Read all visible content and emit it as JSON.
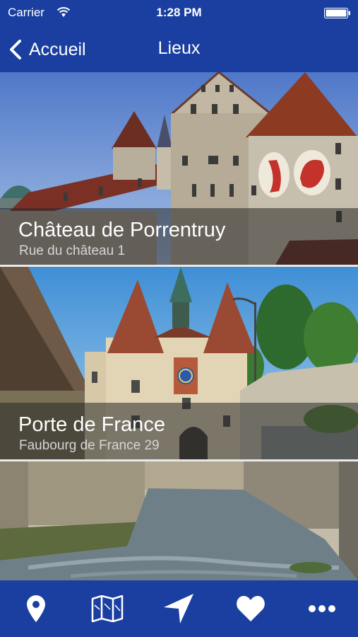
{
  "status": {
    "carrier": "Carrier",
    "time": "1:28 PM"
  },
  "nav": {
    "back_label": "Accueil",
    "title": "Lieux"
  },
  "places": [
    {
      "name": "Château de Porrentruy",
      "address": "Rue du château 1"
    },
    {
      "name": "Porte de France",
      "address": "Faubourg de France 29"
    },
    {
      "name": "",
      "address": ""
    }
  ],
  "tabs": [
    {
      "icon": "location-pin-icon"
    },
    {
      "icon": "map-icon"
    },
    {
      "icon": "navigation-arrow-icon"
    },
    {
      "icon": "heart-icon"
    },
    {
      "icon": "more-icon"
    }
  ],
  "colors": {
    "brand": "#1a3fa0",
    "overlay": "rgba(40,40,40,0.55)"
  }
}
